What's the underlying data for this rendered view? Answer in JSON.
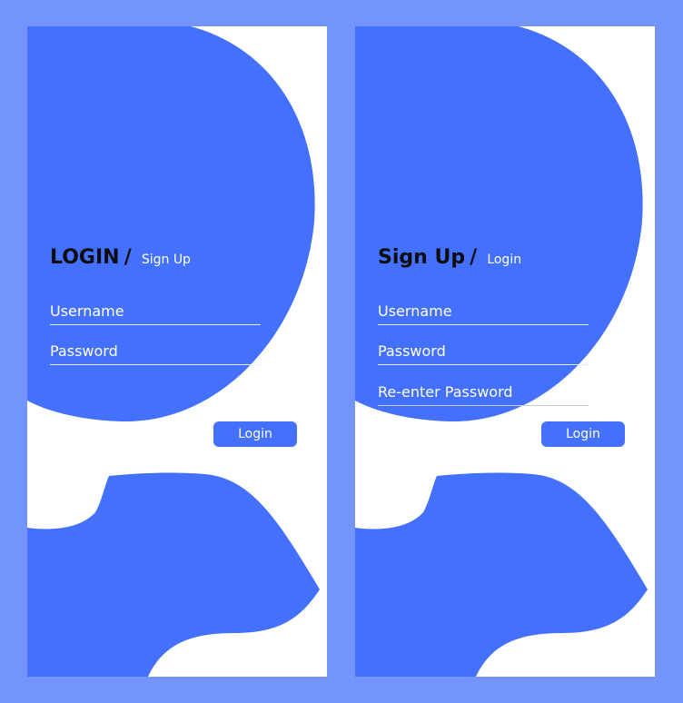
{
  "colors": {
    "page_background": "#7394fc",
    "screen_background": "#ffffff",
    "accent_blue": "#4470fe",
    "title_text": "#0d0d0d",
    "field_text": "#ffffff"
  },
  "login_screen": {
    "title": "LOGIN",
    "separator": "/",
    "alt_link": "Sign Up",
    "fields": [
      {
        "placeholder": "Username"
      },
      {
        "placeholder": "Password"
      }
    ],
    "button_label": "Login"
  },
  "signup_screen": {
    "title": "Sign Up",
    "separator": "/",
    "alt_link": "Login",
    "fields": [
      {
        "placeholder": "Username"
      },
      {
        "placeholder": "Password"
      },
      {
        "placeholder": "Re-enter Password"
      }
    ],
    "button_label": "Login"
  }
}
